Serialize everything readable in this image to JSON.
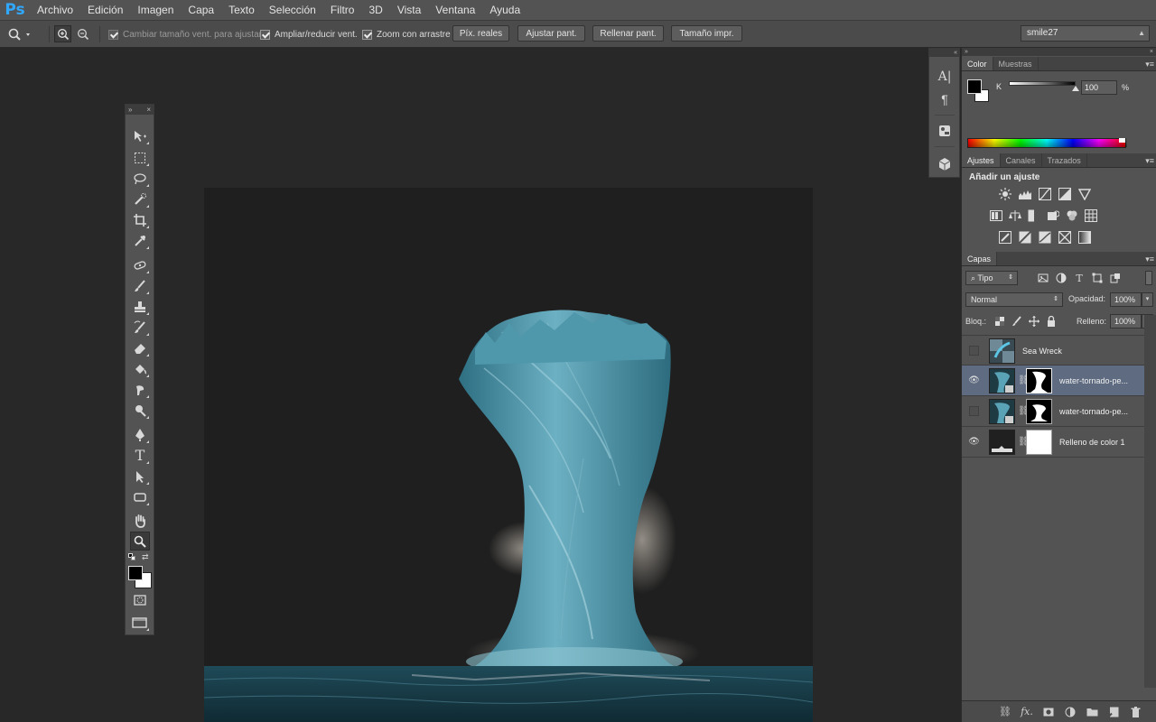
{
  "app": {
    "logo": "Ps"
  },
  "menu": [
    "Archivo",
    "Edición",
    "Imagen",
    "Capa",
    "Texto",
    "Selección",
    "Filtro",
    "3D",
    "Vista",
    "Ventana",
    "Ayuda"
  ],
  "options": {
    "resize_windows_label": "Cambiar tamaño vent. para ajustar",
    "zoom_all_label": "Ampliar/reducir vent.",
    "scrubby_zoom_label": "Zoom con arrastre",
    "actual_pixels": "Píx. reales",
    "fit_screen": "Ajustar pant.",
    "fill_screen": "Rellenar pant.",
    "print_size": "Tamaño impr.",
    "workspace": "smile27"
  },
  "color_panel": {
    "tabs": [
      "Color",
      "Muestras"
    ],
    "channel": "K",
    "value": "100",
    "unit": "%"
  },
  "adjustments_panel": {
    "tabs": [
      "Ajustes",
      "Canales",
      "Trazados"
    ],
    "title": "Añadir un ajuste"
  },
  "layers_panel": {
    "tab": "Capas",
    "filter": "Tipo",
    "blend_mode": "Normal",
    "opacity_label": "Opacidad:",
    "opacity": "100%",
    "lock_label": "Bloq.:",
    "fill_label": "Relleno:",
    "fill": "100%",
    "layers": [
      {
        "name": "Sea Wreck",
        "visible": false,
        "selected": false
      },
      {
        "name": "water-tornado-pe...",
        "visible": true,
        "selected": true
      },
      {
        "name": "water-tornado-pe...",
        "visible": false,
        "selected": false
      },
      {
        "name": "Relleno de color 1",
        "visible": true,
        "selected": false
      }
    ]
  },
  "colors": {
    "menubar": "#535353",
    "panel": "#535353",
    "workspace": "#282828",
    "selected_layer": "#5e6b80",
    "ps_logo": "#31a8ff",
    "water": "#4a9ab0"
  }
}
